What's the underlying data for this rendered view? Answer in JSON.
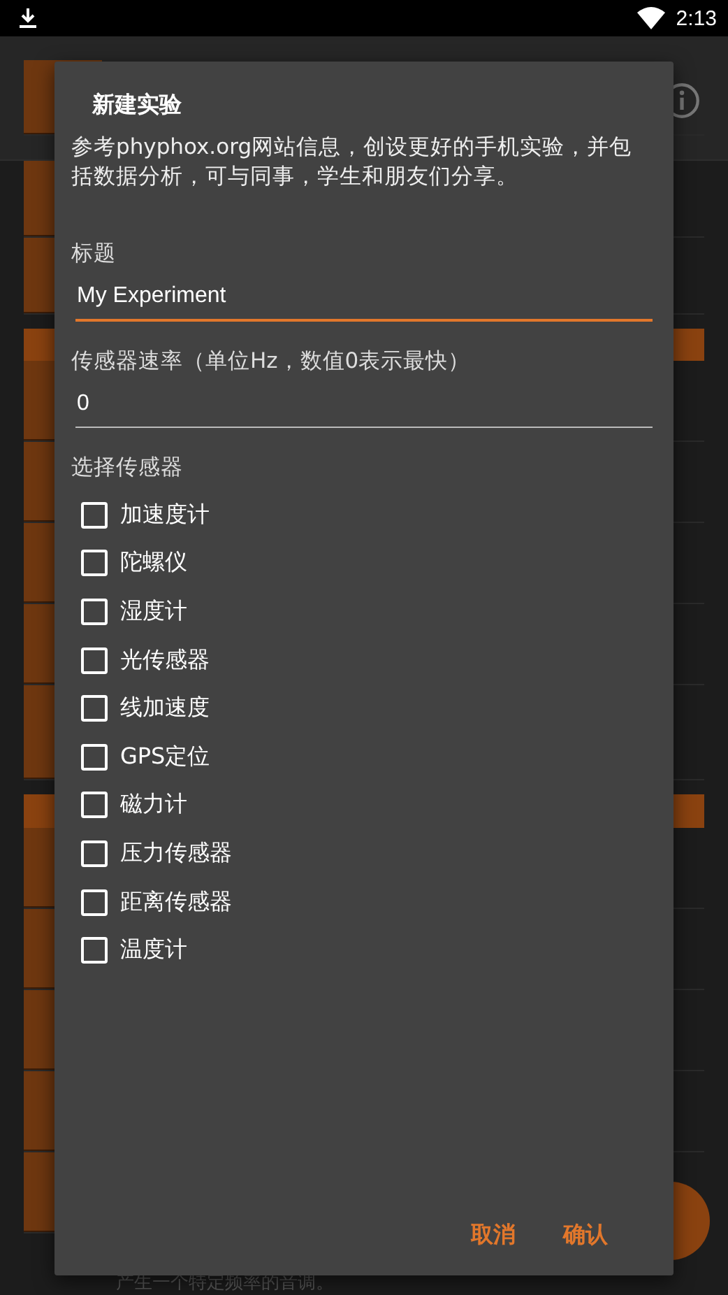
{
  "status_bar": {
    "time": "2:13"
  },
  "dialog": {
    "title": "新建实验",
    "message": "参考phyphox.org网站信息，创设更好的手机实验，并包括数据分析，可与同事，学生和朋友们分享。",
    "fields": [
      {
        "label": "标题",
        "value": "My Experiment",
        "focused": true
      },
      {
        "label": "传感器速率（单位Hz，数值0表示最快）",
        "value": "0",
        "focused": false
      }
    ],
    "sensors_label": "选择传感器",
    "sensors": [
      {
        "label": "加速度计",
        "checked": false
      },
      {
        "label": "陀螺仪",
        "checked": false
      },
      {
        "label": "湿度计",
        "checked": false
      },
      {
        "label": "光传感器",
        "checked": false
      },
      {
        "label": "线加速度",
        "checked": false
      },
      {
        "label": "GPS定位",
        "checked": false
      },
      {
        "label": "磁力计",
        "checked": false
      },
      {
        "label": "压力传感器",
        "checked": false
      },
      {
        "label": "距离传感器",
        "checked": false
      },
      {
        "label": "温度计",
        "checked": false
      }
    ],
    "buttons": [
      "取消",
      "确认"
    ]
  },
  "background": {
    "description": "产生一个特定频率的音调。"
  }
}
